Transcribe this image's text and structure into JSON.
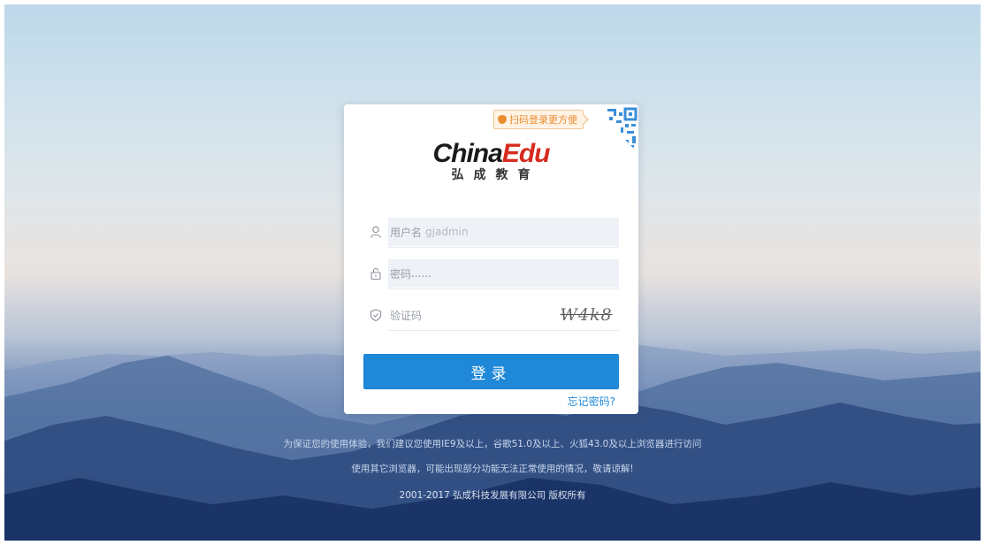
{
  "login": {
    "scan_tip": "扫码登录更方便",
    "logo_en_part1": "China",
    "logo_en_part2": "Edu",
    "logo_cn": "弘成教育",
    "username": {
      "placeholder": "用户名",
      "value": "gjadmin"
    },
    "password": {
      "placeholder": "密码",
      "value": "......"
    },
    "captcha": {
      "placeholder": "验证码",
      "image_text": "W4k8"
    },
    "submit_label": "登录",
    "forgot_label": "忘记密码?"
  },
  "footer": {
    "line1": "为保证您的使用体验，我们建议您使用IE9及以上，谷歌51.0及以上、火狐43.0及以上浏览器进行访问",
    "line2": "使用其它浏览器，可能出现部分功能无法正常使用的情况，敬请谅解!",
    "copyright": "2001-2017 弘成科技发展有限公司 版权所有"
  },
  "colors": {
    "accent": "#1f88d8",
    "brand_red": "#d62b1e",
    "tip_orange": "#e98d2f"
  },
  "icons": [
    "user-icon",
    "lock-icon",
    "shield-icon",
    "qr-code-icon"
  ]
}
